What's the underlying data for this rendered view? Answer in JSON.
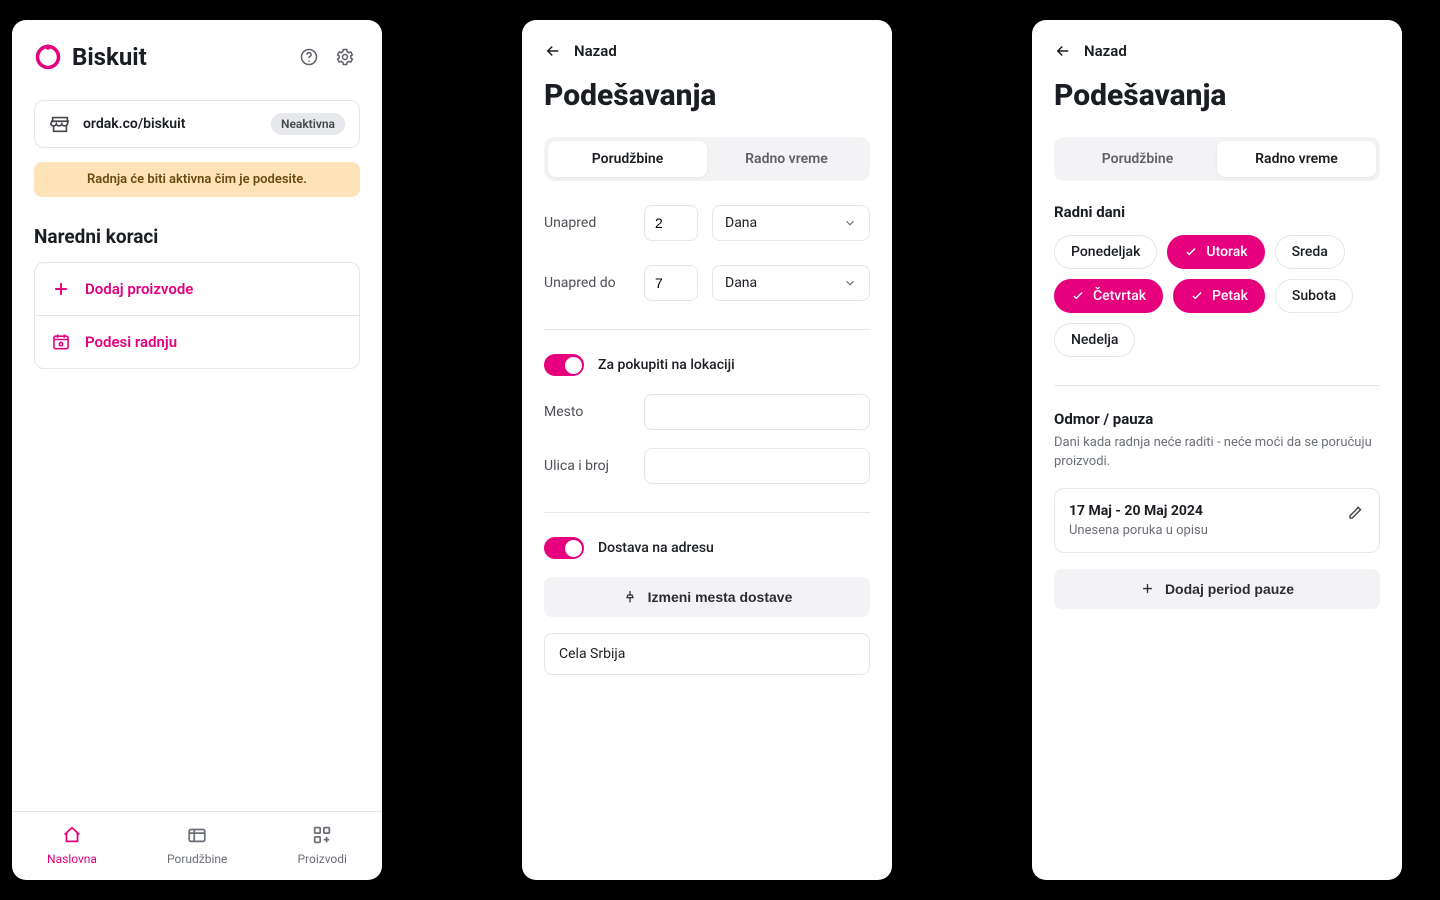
{
  "colors": {
    "accent": "#E6007E"
  },
  "panel1": {
    "brand": "Biskuit",
    "url": "ordak.co/biskuit",
    "status_badge": "Neaktivna",
    "warning": "Radnja će biti aktivna čim je podesite.",
    "next_steps_title": "Naredni koraci",
    "steps": [
      {
        "label": "Dodaj proizvode"
      },
      {
        "label": "Podesi radnju"
      }
    ],
    "nav": [
      {
        "label": "Naslovna",
        "active": true
      },
      {
        "label": "Porudžbine",
        "active": false
      },
      {
        "label": "Proizvodi",
        "active": false
      }
    ]
  },
  "panel2": {
    "back": "Nazad",
    "title": "Podešavanja",
    "tabs": {
      "orders": "Porudžbine",
      "hours": "Radno vreme",
      "active": "orders"
    },
    "lead_label": "Unapred",
    "lead_value": "2",
    "lead_unit": "Dana",
    "lead_until_label": "Unapred do",
    "lead_until_value": "7",
    "lead_until_unit": "Dana",
    "pickup_toggle_label": "Za pokupiti na lokaciji",
    "city_label": "Mesto",
    "street_label": "Ulica i broj",
    "delivery_toggle_label": "Dostava na adresu",
    "edit_delivery_btn": "Izmeni mesta dostave",
    "region": "Cela Srbija"
  },
  "panel3": {
    "back": "Nazad",
    "title": "Podešavanja",
    "tabs": {
      "orders": "Porudžbine",
      "hours": "Radno vreme",
      "active": "hours"
    },
    "workdays_title": "Radni dani",
    "days": [
      {
        "label": "Ponedeljak",
        "on": false
      },
      {
        "label": "Utorak",
        "on": true
      },
      {
        "label": "Sreda",
        "on": false
      },
      {
        "label": "Četvrtak",
        "on": true
      },
      {
        "label": "Petak",
        "on": true
      },
      {
        "label": "Subota",
        "on": false
      },
      {
        "label": "Nedelja",
        "on": false
      }
    ],
    "vac_title": "Odmor / pauza",
    "vac_desc": "Dani kada radnja neće raditi - neće moći da se poručuju proizvodi.",
    "vac_range": "17 Maj - 20 Maj 2024",
    "vac_note": "Unesena poruka u opisu",
    "add_vac_btn": "Dodaj period pauze"
  }
}
